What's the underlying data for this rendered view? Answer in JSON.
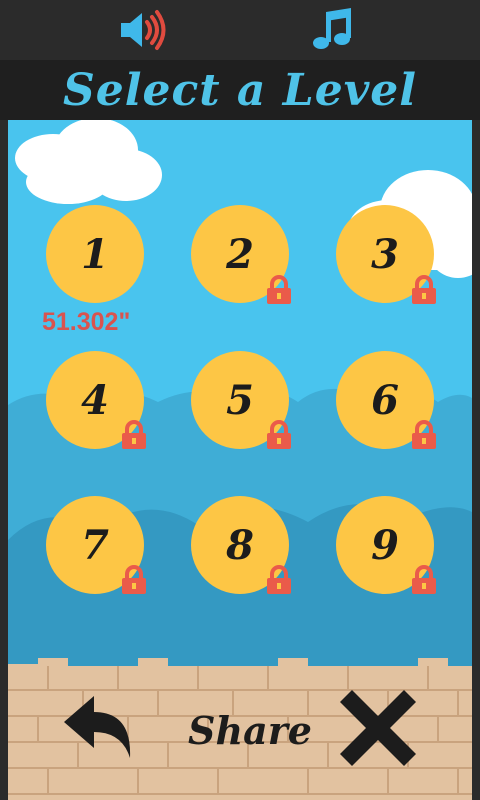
{
  "header": {
    "title": "Select a Level",
    "sound_icon": "speaker-icon",
    "music_icon": "music-note-icon"
  },
  "levels": [
    {
      "label": "1",
      "locked": false,
      "best_time": "51.302\""
    },
    {
      "label": "2",
      "locked": true
    },
    {
      "label": "3",
      "locked": true
    },
    {
      "label": "4",
      "locked": true
    },
    {
      "label": "5",
      "locked": true
    },
    {
      "label": "6",
      "locked": true
    },
    {
      "label": "7",
      "locked": true
    },
    {
      "label": "8",
      "locked": true
    },
    {
      "label": "9",
      "locked": true
    }
  ],
  "footer": {
    "back_icon": "back-arrow-icon",
    "share_label": "Share",
    "close_icon": "close-x-icon"
  },
  "colors": {
    "sky": "#49c4ee",
    "level_circle": "#fdc645",
    "lock": "#ea5b4a",
    "title": "#4fc3e8",
    "time": "#d9534f"
  }
}
